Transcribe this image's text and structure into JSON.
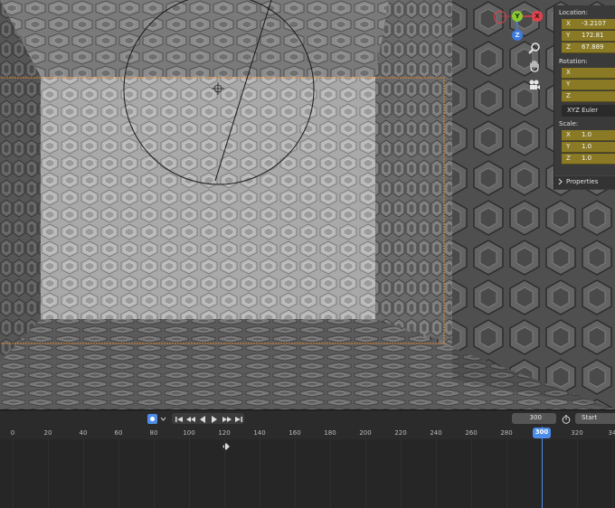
{
  "viewport": {
    "gizmo": {
      "x_label": "X",
      "y_label": "Y",
      "z_label": "Z"
    },
    "nav_icons": [
      "zoom-icon",
      "hand-pan-icon",
      "camera-icon"
    ]
  },
  "n_panel": {
    "location_label": "Location:",
    "location": [
      {
        "axis": "X",
        "value": "-3.2107"
      },
      {
        "axis": "Y",
        "value": "172.81"
      },
      {
        "axis": "Z",
        "value": "67.889"
      }
    ],
    "rotation_label": "Rotation:",
    "rotation": [
      {
        "axis": "X",
        "value": ""
      },
      {
        "axis": "Y",
        "value": ""
      },
      {
        "axis": "Z",
        "value": ""
      }
    ],
    "rotation_mode": "XYZ Euler",
    "scale_label": "Scale:",
    "scale": [
      {
        "axis": "X",
        "value": "1.0"
      },
      {
        "axis": "Y",
        "value": "1.0"
      },
      {
        "axis": "Z",
        "value": "1.0"
      }
    ],
    "properties_label": "Properties"
  },
  "timeline": {
    "current_frame": "300",
    "start_label": "Start",
    "ticks": [
      "0",
      "20",
      "40",
      "60",
      "80",
      "100",
      "120",
      "140",
      "160",
      "180",
      "200",
      "220",
      "240",
      "260",
      "280",
      "300",
      "320",
      "34"
    ],
    "playhead_label": "300"
  },
  "colors": {
    "accent": "#4d8ce8",
    "keyed_field": "#8a7a26",
    "x_axis": "#e4404a",
    "y_axis": "#88c930",
    "z_axis": "#3c7be0"
  }
}
